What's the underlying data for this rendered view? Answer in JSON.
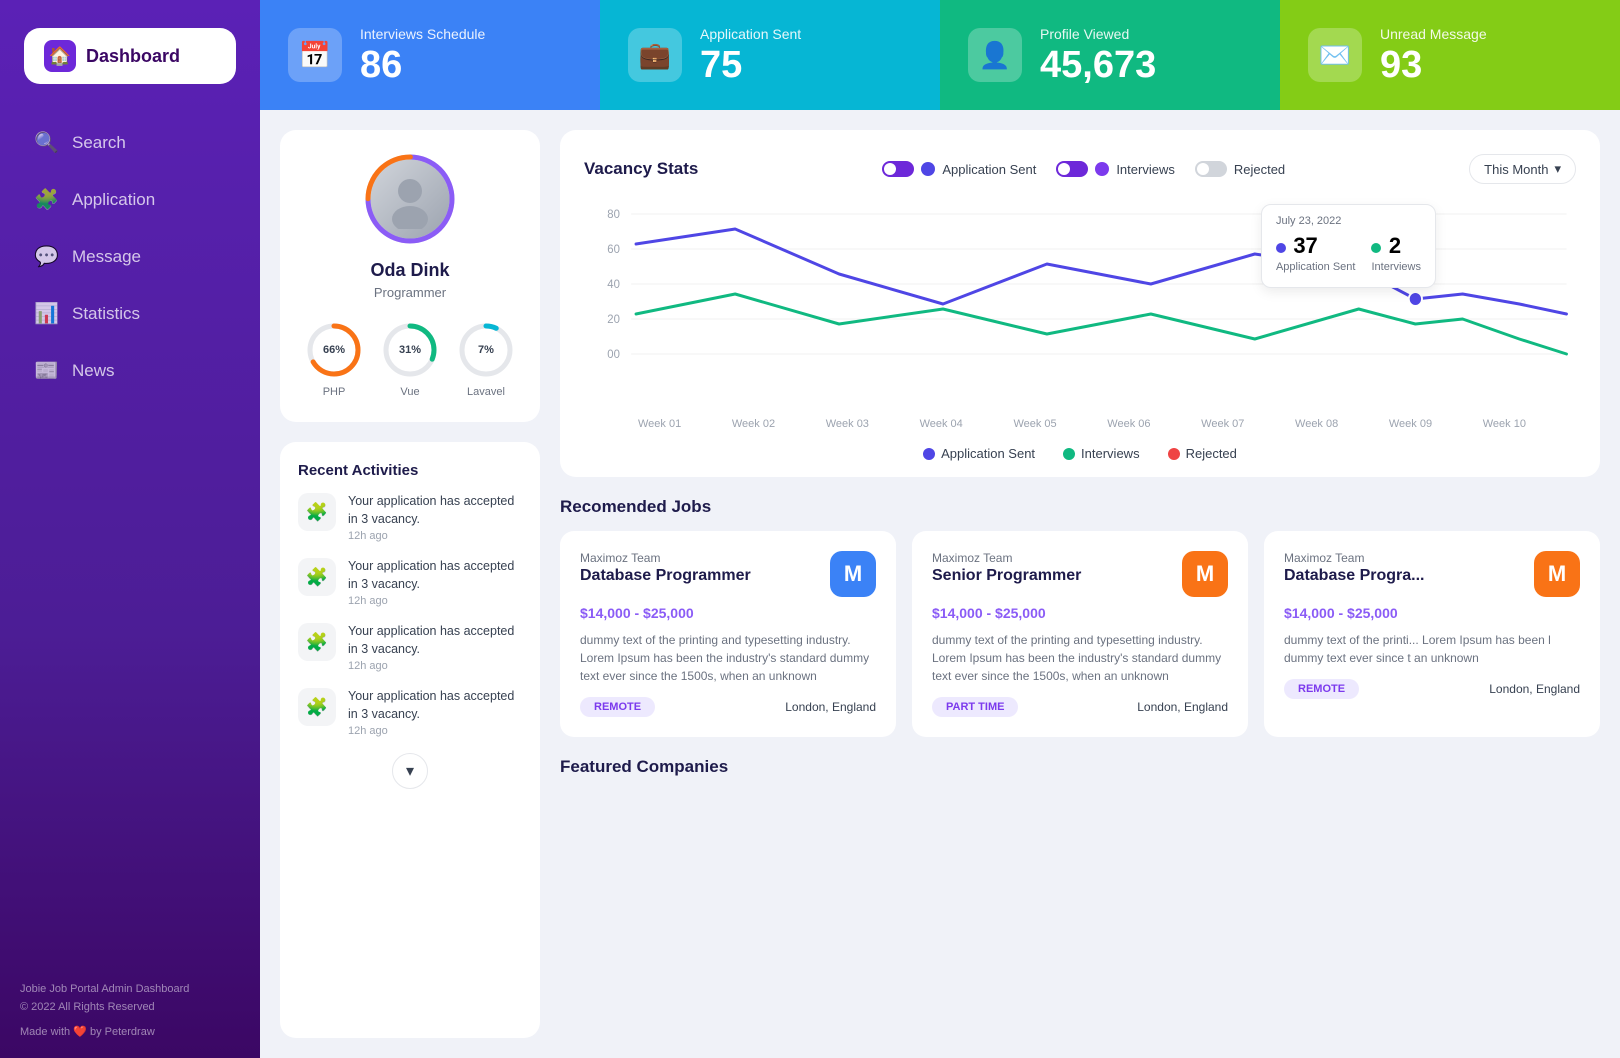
{
  "sidebar": {
    "logo": {
      "text": "Dashboard",
      "icon": "🏠"
    },
    "items": [
      {
        "id": "search",
        "label": "Search",
        "icon": "🔍",
        "active": false
      },
      {
        "id": "application",
        "label": "Application",
        "icon": "🧩",
        "active": false
      },
      {
        "id": "message",
        "label": "Message",
        "icon": "💬",
        "active": false
      },
      {
        "id": "statistics",
        "label": "Statistics",
        "icon": "📊",
        "active": false
      },
      {
        "id": "news",
        "label": "News",
        "icon": "📰",
        "active": false
      }
    ],
    "footer": {
      "copyright": "Jobie Job Portal Admin Dashboard\n© 2022 All Rights Reserved",
      "made_with": "Made with",
      "by": "by Peterdraw"
    }
  },
  "stats": [
    {
      "id": "interviews",
      "label": "Interviews Schedule",
      "value": "86",
      "color": "blue",
      "icon": "📅"
    },
    {
      "id": "applications",
      "label": "Application Sent",
      "value": "75",
      "color": "cyan",
      "icon": "💼"
    },
    {
      "id": "profile",
      "label": "Profile Viewed",
      "value": "45,673",
      "color": "green",
      "icon": "👤"
    },
    {
      "id": "messages",
      "label": "Unread Message",
      "value": "93",
      "color": "lime",
      "icon": "✉️"
    }
  ],
  "profile": {
    "name": "Oda Dink",
    "role": "Programmer",
    "skills": [
      {
        "label": "PHP",
        "pct": 66,
        "color": "#f97316"
      },
      {
        "label": "Vue",
        "pct": 31,
        "color": "#10b981"
      },
      {
        "label": "Lavavel",
        "pct": 7,
        "color": "#06b6d4"
      }
    ]
  },
  "activities": {
    "title": "Recent Activities",
    "items": [
      {
        "text": "Your application has accepted in 3 vacancy.",
        "time": "12h ago"
      },
      {
        "text": "Your application has accepted in 3 vacancy.",
        "time": "12h ago"
      },
      {
        "text": "Your application has accepted in 3 vacancy.",
        "time": "12h ago"
      },
      {
        "text": "Your application has accepted in 3 vacancy.",
        "time": "12h ago"
      }
    ]
  },
  "chart": {
    "title": "Vacancy Stats",
    "filter": "This Month",
    "legend": [
      {
        "label": "Application Sent",
        "color": "#4f46e5",
        "active": true
      },
      {
        "label": "Interviews",
        "color": "#7c3aed",
        "active": true
      },
      {
        "label": "Rejected",
        "color": "#9ca3af",
        "active": false
      }
    ],
    "tooltip": {
      "date": "July 23, 2022",
      "app_sent_val": "37",
      "app_sent_label": "Application Sent",
      "interviews_val": "2",
      "interviews_label": "Interviews"
    },
    "x_labels": [
      "Week 01",
      "Week 02",
      "Week 03",
      "Week 04",
      "Week 05",
      "Week 06",
      "Week 07",
      "Week 08",
      "Week 09",
      "Week 10"
    ],
    "y_labels": [
      "80",
      "60",
      "40",
      "20",
      "00"
    ],
    "footer_legend": [
      {
        "label": "Application Sent",
        "color": "#4f46e5"
      },
      {
        "label": "Interviews",
        "color": "#10b981"
      },
      {
        "label": "Rejected",
        "color": "#ef4444"
      }
    ]
  },
  "recommended_jobs": {
    "title": "Recomended Jobs",
    "jobs": [
      {
        "company": "Maximoz Team",
        "title": "Database Programmer",
        "salary": "$14,000 - $25,000",
        "desc": "dummy text of the printing and typesetting industry. Lorem Ipsum has been the industry's standard dummy text ever since the 1500s, when an unknown",
        "tag": "REMOTE",
        "location": "London, England",
        "logo_text": "M",
        "logo_color": "blue-logo"
      },
      {
        "company": "Maximoz Team",
        "title": "Senior Programmer",
        "salary": "$14,000 - $25,000",
        "desc": "dummy text of the printing and typesetting industry. Lorem Ipsum has been the industry's standard dummy text ever since the 1500s, when an unknown",
        "tag": "PART TIME",
        "location": "London, England",
        "logo_text": "M",
        "logo_color": "orange-logo"
      },
      {
        "company": "Maximoz Team",
        "title": "Database Progra...",
        "salary": "$14,000 - $25,000",
        "desc": "dummy text of the printi... Lorem Ipsum has been l dummy text ever since t an unknown",
        "tag": "REMOTE",
        "location": "London, England",
        "logo_text": "M",
        "logo_color": "orange-logo"
      }
    ]
  },
  "featured_companies": {
    "title": "Featured Companies"
  }
}
